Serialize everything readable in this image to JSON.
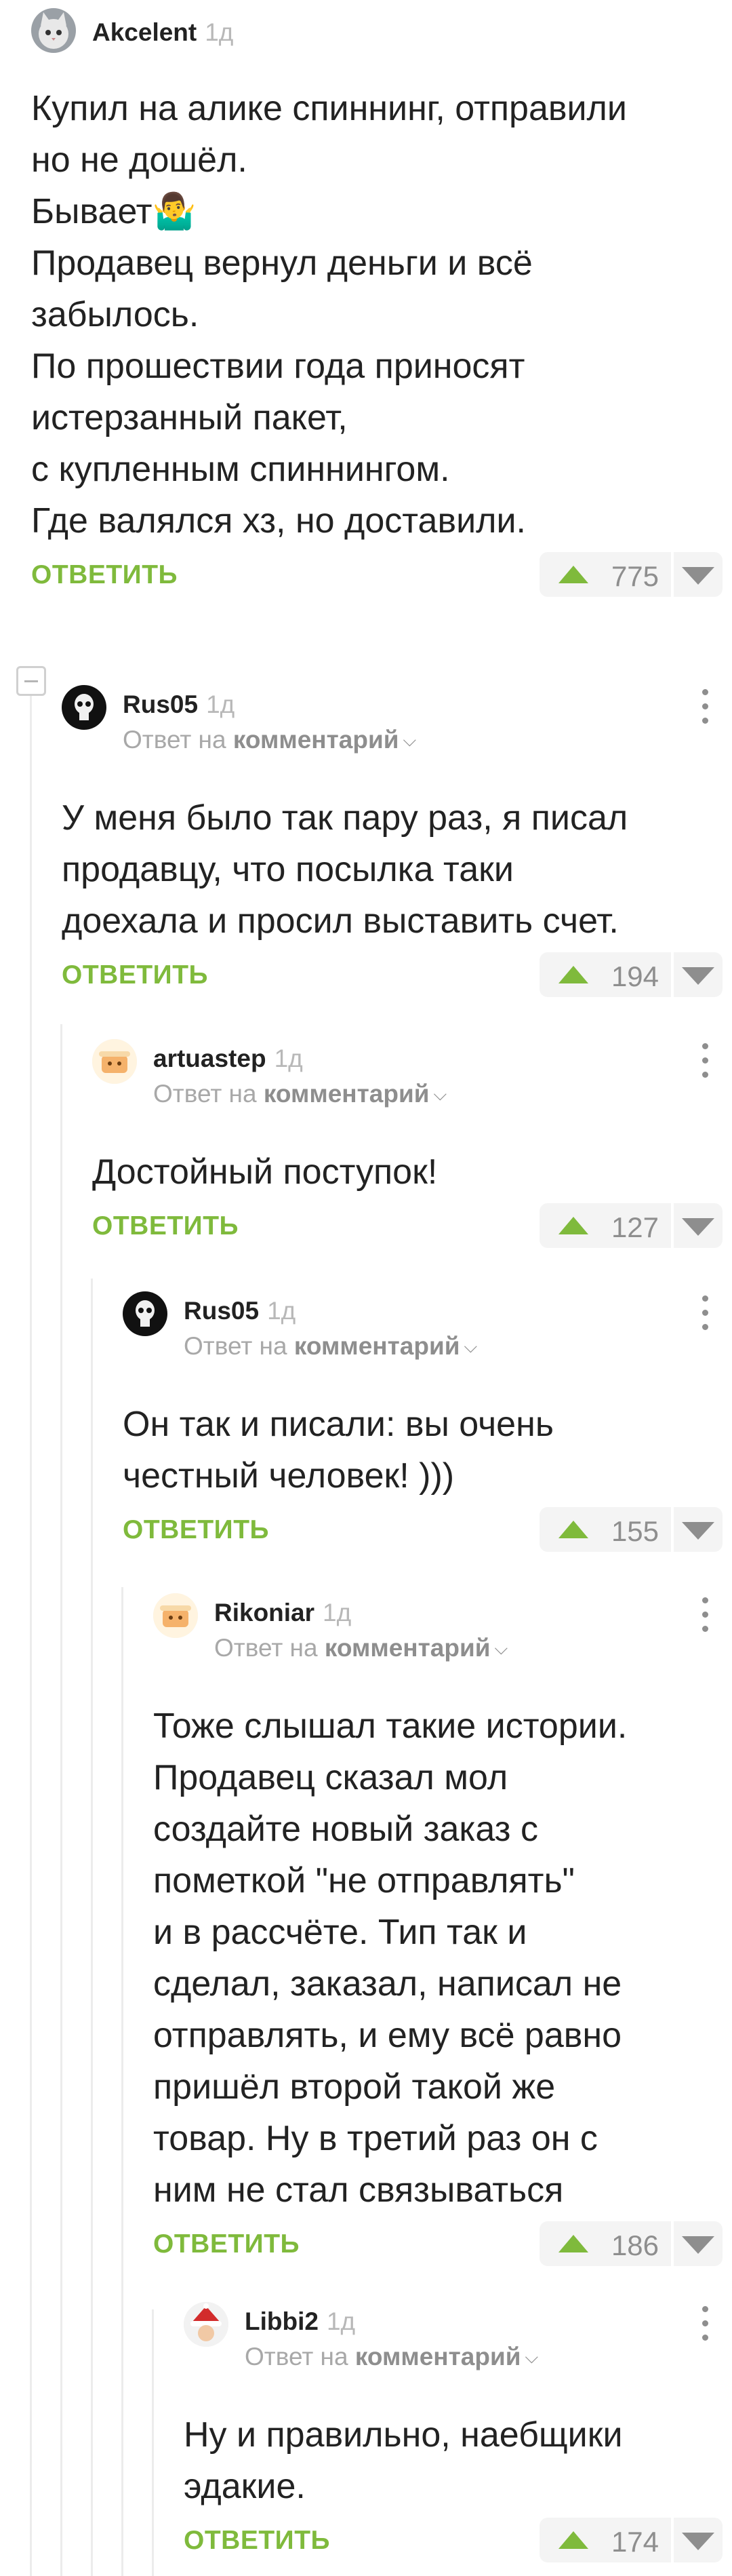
{
  "colors": {
    "accent": "#7fba3c",
    "muted": "#8e8e8e",
    "text": "#222222"
  },
  "comments": [
    {
      "author": "Akcelent",
      "age": "1д",
      "avatar": "cat-avatar",
      "reply_prefix": "",
      "reply_target": "",
      "text": "Купил на алике спиннинг, отправили\nно не дошёл.\nБывает🤷‍♂️\nПродавец вернул деньги и всё\nзабылось.\nПо прошествии года приносят\nистерзанный пакет,\nс купленным спиннингом.\nГде валялся хз, но доставили.",
      "reply_label": "ОТВЕТИТЬ",
      "score": "775"
    },
    {
      "author": "Rus05",
      "age": "1д",
      "avatar": "skull-avatar",
      "reply_prefix": "Ответ на",
      "reply_target": "комментарий",
      "text": "У меня было так пару раз, я писал\nпродавцу, что посылка таки\nдоехала и просил выставить счет.",
      "reply_label": "ОТВЕТИТЬ",
      "score": "194"
    },
    {
      "author": "artuastep",
      "age": "1д",
      "avatar": "default-avatar",
      "reply_prefix": "Ответ на",
      "reply_target": "комментарий",
      "text": "Достойный поступок!",
      "reply_label": "ОТВЕТИТЬ",
      "score": "127"
    },
    {
      "author": "Rus05",
      "age": "1д",
      "avatar": "skull-avatar",
      "reply_prefix": "Ответ на",
      "reply_target": "комментарий",
      "text": "Он так и писали: вы очень\nчестный человек! )))",
      "reply_label": "ОТВЕТИТЬ",
      "score": "155"
    },
    {
      "author": "Rikoniar",
      "age": "1д",
      "avatar": "default-avatar",
      "reply_prefix": "Ответ на",
      "reply_target": "комментарий",
      "text": "Тоже слышал такие истории.\nПродавец сказал мол\nсоздайте новый заказ с\nпометкой \"не отправлять\"\nи в рассчёте. Тип так и\nсделал, заказал, написал не\nотправлять, и ему всё равно\nпришёл второй такой же\nтовар. Ну в третий раз он с\nним не стал связываться",
      "reply_label": "ОТВЕТИТЬ",
      "score": "186"
    },
    {
      "author": "Libbi2",
      "age": "1д",
      "avatar": "santa-avatar",
      "reply_prefix": "Ответ на",
      "reply_target": "комментарий",
      "text": "Ну и правильно, наебщики\nэдакие.",
      "reply_label": "ОТВЕТИТЬ",
      "score": "174"
    }
  ]
}
